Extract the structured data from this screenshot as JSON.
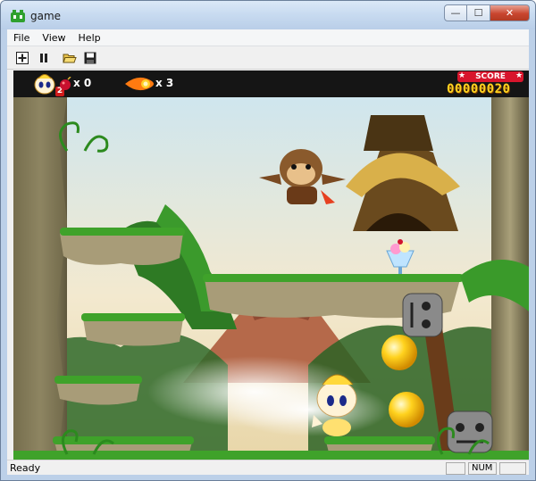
{
  "window": {
    "title": "game",
    "controls": {
      "minimize": "—",
      "maximize": "☐",
      "close": "✕"
    }
  },
  "menu": {
    "items": [
      "File",
      "View",
      "Help"
    ]
  },
  "toolbar": {
    "buttons": [
      "new-game",
      "pause",
      "open",
      "save"
    ]
  },
  "hud": {
    "lives": {
      "count": "x 0",
      "level_badge": "2"
    },
    "fireballs": {
      "count": "x 3"
    },
    "score": {
      "label": "SCORE",
      "value": "00000020"
    }
  },
  "statusbar": {
    "text": "Ready",
    "panes": [
      "",
      "NUM",
      ""
    ]
  },
  "colors": {
    "hud_bg": "#151515",
    "score_gold": "#ffd320",
    "score_label_bg": "#d8152c",
    "grass": "#3fa22a"
  }
}
